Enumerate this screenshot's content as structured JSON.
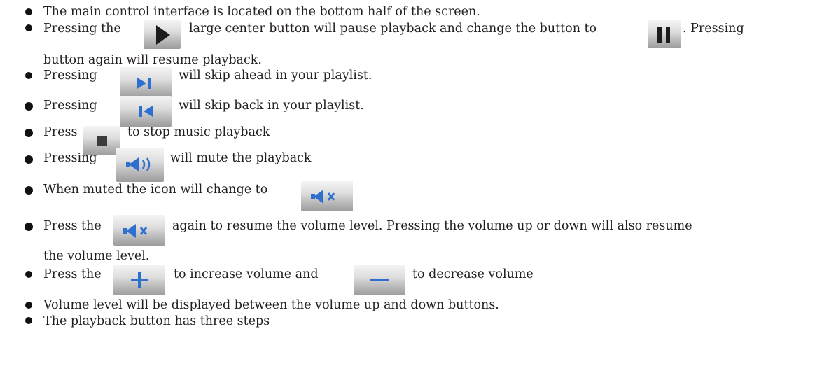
{
  "items": [
    {
      "text": "The main control interface is located on the bottom half of the screen."
    },
    {
      "pre": "Pressing the",
      "mid": "large center button will pause playback and change the button to",
      "post": ". Pressing",
      "cont": "button again will resume playback.",
      "icon1": "play-icon",
      "icon2": "pause-icon"
    },
    {
      "pre": "Pressing",
      "post": "will skip ahead in your playlist.",
      "icon": "skip-forward-icon"
    },
    {
      "pre": "Pressing",
      "post": "will skip back in your playlist.",
      "icon": "skip-back-icon"
    },
    {
      "pre": "Press",
      "post": "to stop music playback",
      "icon": "stop-icon"
    },
    {
      "pre": "Pressing",
      "post": "will mute the playback",
      "icon": "volume-icon"
    },
    {
      "pre": "When muted the icon will change to",
      "icon": "muted-icon"
    },
    {
      "pre": "Press the",
      "post": "again to resume the volume level. Pressing the volume up or down will also resume",
      "cont": "the volume level.",
      "icon": "muted-icon"
    },
    {
      "pre": "Press the",
      "mid": "to increase volume and",
      "post": "to decrease volume",
      "icon1": "plus-icon",
      "icon2": "minus-icon"
    },
    {
      "text": "Volume level will be displayed between the volume up and down buttons."
    },
    {
      "text": "The playback button has three steps"
    }
  ],
  "colors": {
    "text": "#231f20",
    "icon_blue": "#2f6fd0",
    "icon_dark": "#222222"
  }
}
